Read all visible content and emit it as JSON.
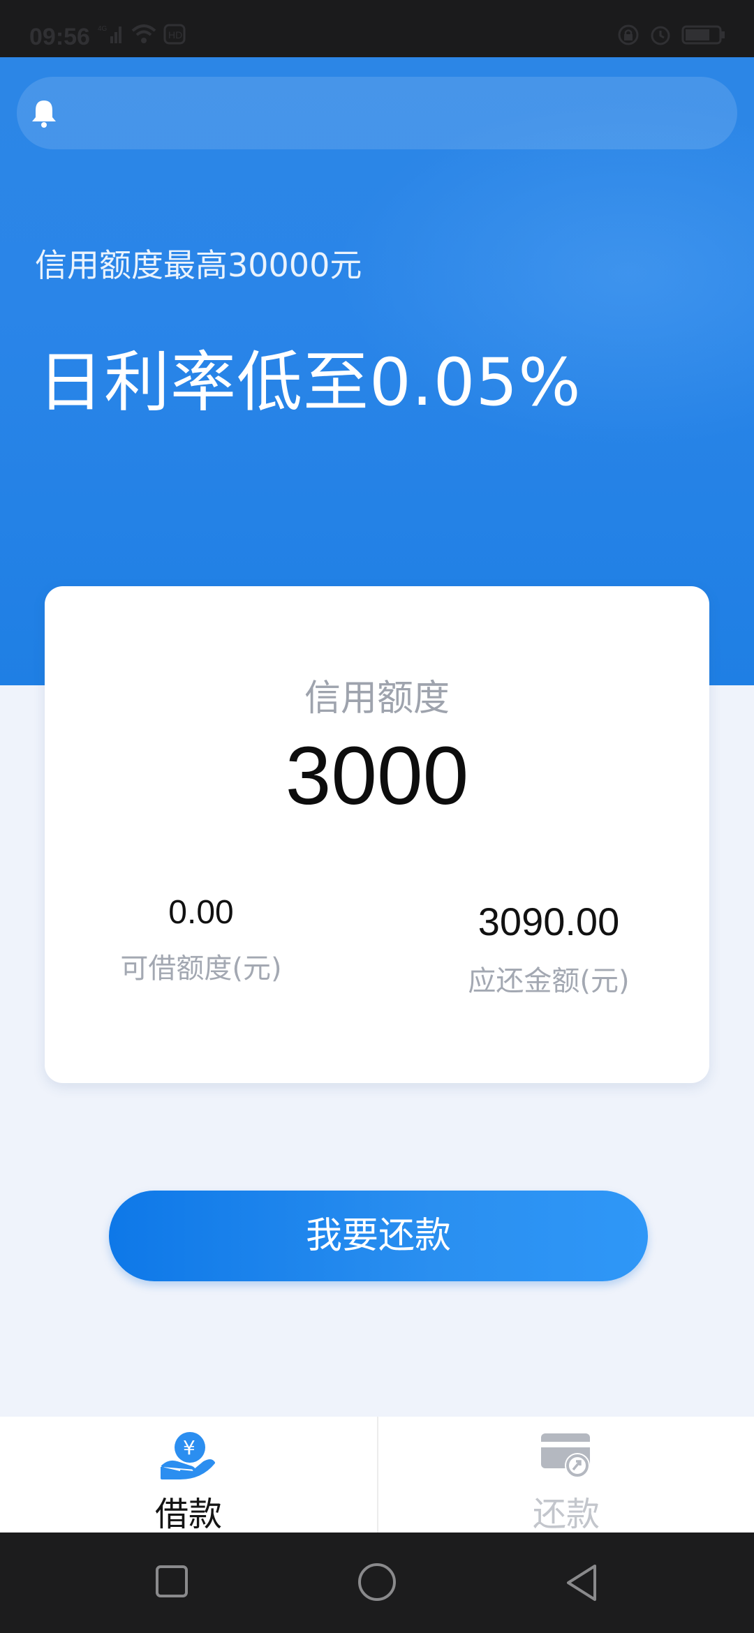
{
  "status_bar": {
    "time": "09:56",
    "network": "4G",
    "left_icons": [
      "signal-icon",
      "wifi-icon",
      "hd-icon"
    ],
    "right_icons": [
      "lock-icon",
      "alarm-icon",
      "battery-icon"
    ]
  },
  "hero": {
    "notice_icon": "bell-icon",
    "subtitle": "信用额度最高30000元",
    "title": "日利率低至0.05%"
  },
  "card": {
    "label": "信用额度",
    "amount": "3000",
    "available": {
      "value": "0.00",
      "caption": "可借额度(元)"
    },
    "due": {
      "value": "3090.00",
      "caption": "应还金额(元)"
    }
  },
  "actions": {
    "repay_label": "我要还款"
  },
  "tab_bar": {
    "tabs": [
      {
        "label": "借款",
        "icon": "loan-hand-icon",
        "active": true
      },
      {
        "label": "还款",
        "icon": "repay-card-icon",
        "active": false
      }
    ]
  },
  "nav_bar": {
    "buttons": [
      "recent-apps-icon",
      "home-icon",
      "back-icon"
    ]
  },
  "colors": {
    "hero_blue": "#2a85e8",
    "button_blue": "#1a84ec",
    "page_bg": "#eff3fb"
  }
}
